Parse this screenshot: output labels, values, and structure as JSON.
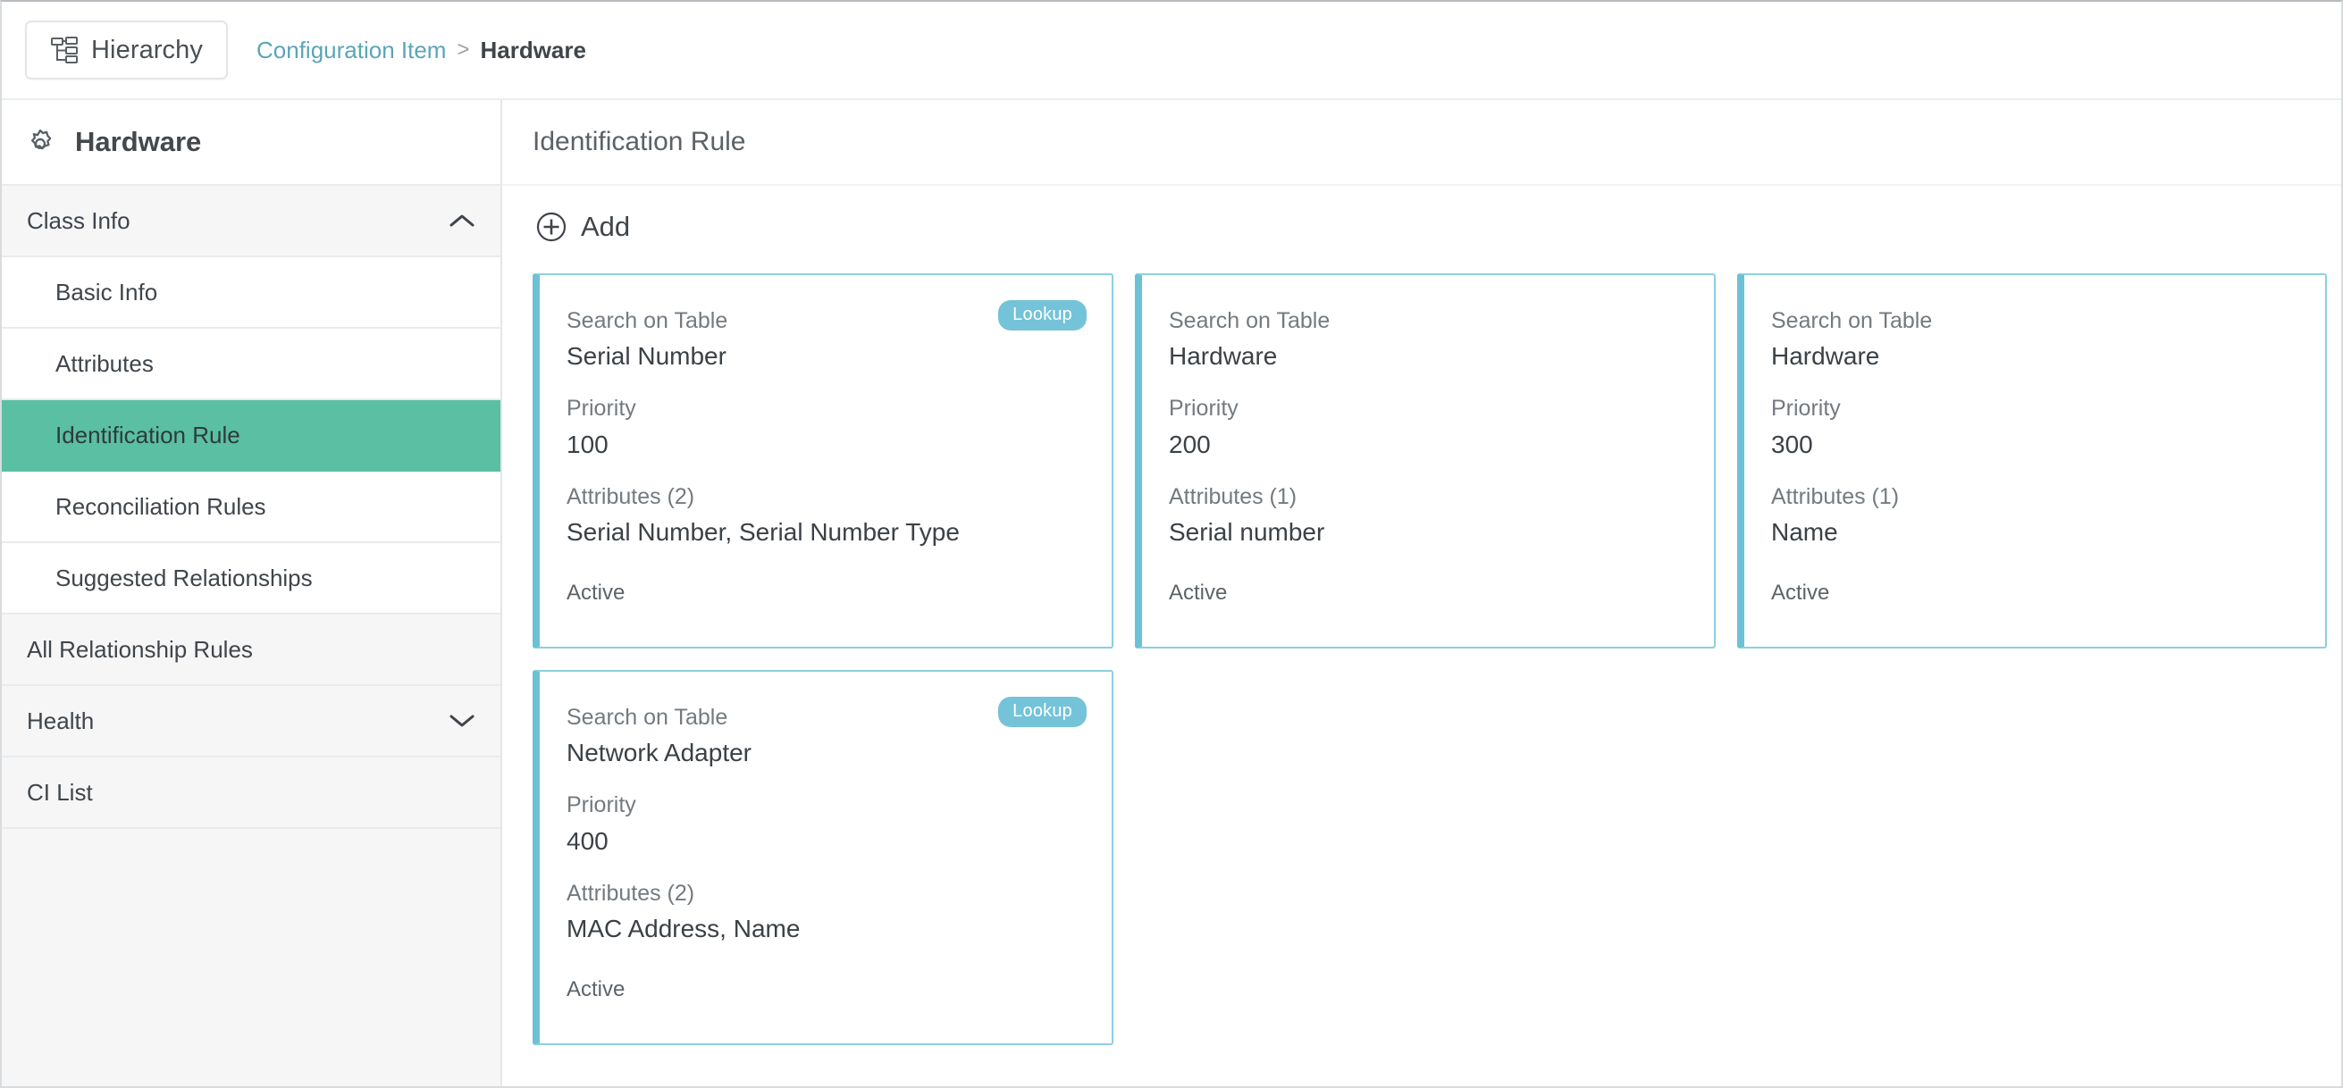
{
  "topbar": {
    "hierarchy_button": "Hierarchy",
    "hierarchy_icon": "sitemap-icon",
    "breadcrumb": {
      "root": "Configuration Item",
      "separator": ">",
      "current": "Hardware"
    }
  },
  "sidebar": {
    "title": "Hardware",
    "title_icon": "gear-icon",
    "items": [
      {
        "label": "Class Info",
        "level": 0,
        "selected": false,
        "chevron": "chevron-up-icon"
      },
      {
        "label": "Basic Info",
        "level": 1,
        "selected": false,
        "chevron": ""
      },
      {
        "label": "Attributes",
        "level": 1,
        "selected": false,
        "chevron": ""
      },
      {
        "label": "Identification Rule",
        "level": 1,
        "selected": true,
        "chevron": ""
      },
      {
        "label": "Reconciliation Rules",
        "level": 1,
        "selected": false,
        "chevron": ""
      },
      {
        "label": "Suggested Relationships",
        "level": 1,
        "selected": false,
        "chevron": ""
      },
      {
        "label": "All Relationship Rules",
        "level": 0,
        "selected": false,
        "chevron": ""
      },
      {
        "label": "Health",
        "level": 0,
        "selected": false,
        "chevron": "chevron-down-icon"
      },
      {
        "label": "CI List",
        "level": 0,
        "selected": false,
        "chevron": ""
      }
    ]
  },
  "main": {
    "header_title": "Identification Rule",
    "add_button": "Add",
    "add_icon": "plus-circle-icon",
    "field_labels": {
      "search_on_table": "Search on Table",
      "priority": "Priority",
      "attributes": "Attributes"
    },
    "cards": [
      {
        "search_on_table_label": "Search on Table",
        "search_on_table_value": "Serial Number",
        "priority_label": "Priority",
        "priority_value": "100",
        "attributes_label": "Attributes (2)",
        "attributes_value": "Serial Number, Serial Number Type",
        "status": "Active",
        "badge": "Lookup"
      },
      {
        "search_on_table_label": "Search on Table",
        "search_on_table_value": "Hardware",
        "priority_label": "Priority",
        "priority_value": "200",
        "attributes_label": "Attributes (1)",
        "attributes_value": "Serial number",
        "status": "Active",
        "badge": ""
      },
      {
        "search_on_table_label": "Search on Table",
        "search_on_table_value": "Hardware",
        "priority_label": "Priority",
        "priority_value": "300",
        "attributes_label": "Attributes (1)",
        "attributes_value": "Name",
        "status": "Active",
        "badge": ""
      },
      {
        "search_on_table_label": "Search on Table",
        "search_on_table_value": "Network Adapter",
        "priority_label": "Priority",
        "priority_value": "400",
        "attributes_label": "Attributes (2)",
        "attributes_value": "MAC Address, Name",
        "status": "Active",
        "badge": "Lookup"
      }
    ]
  },
  "colors": {
    "selected_nav": "#5abfa3",
    "card_border": "#8dcfe0",
    "card_accent": "#6cc1d6",
    "badge": "#74c3d9",
    "link": "#5aa6b5"
  }
}
